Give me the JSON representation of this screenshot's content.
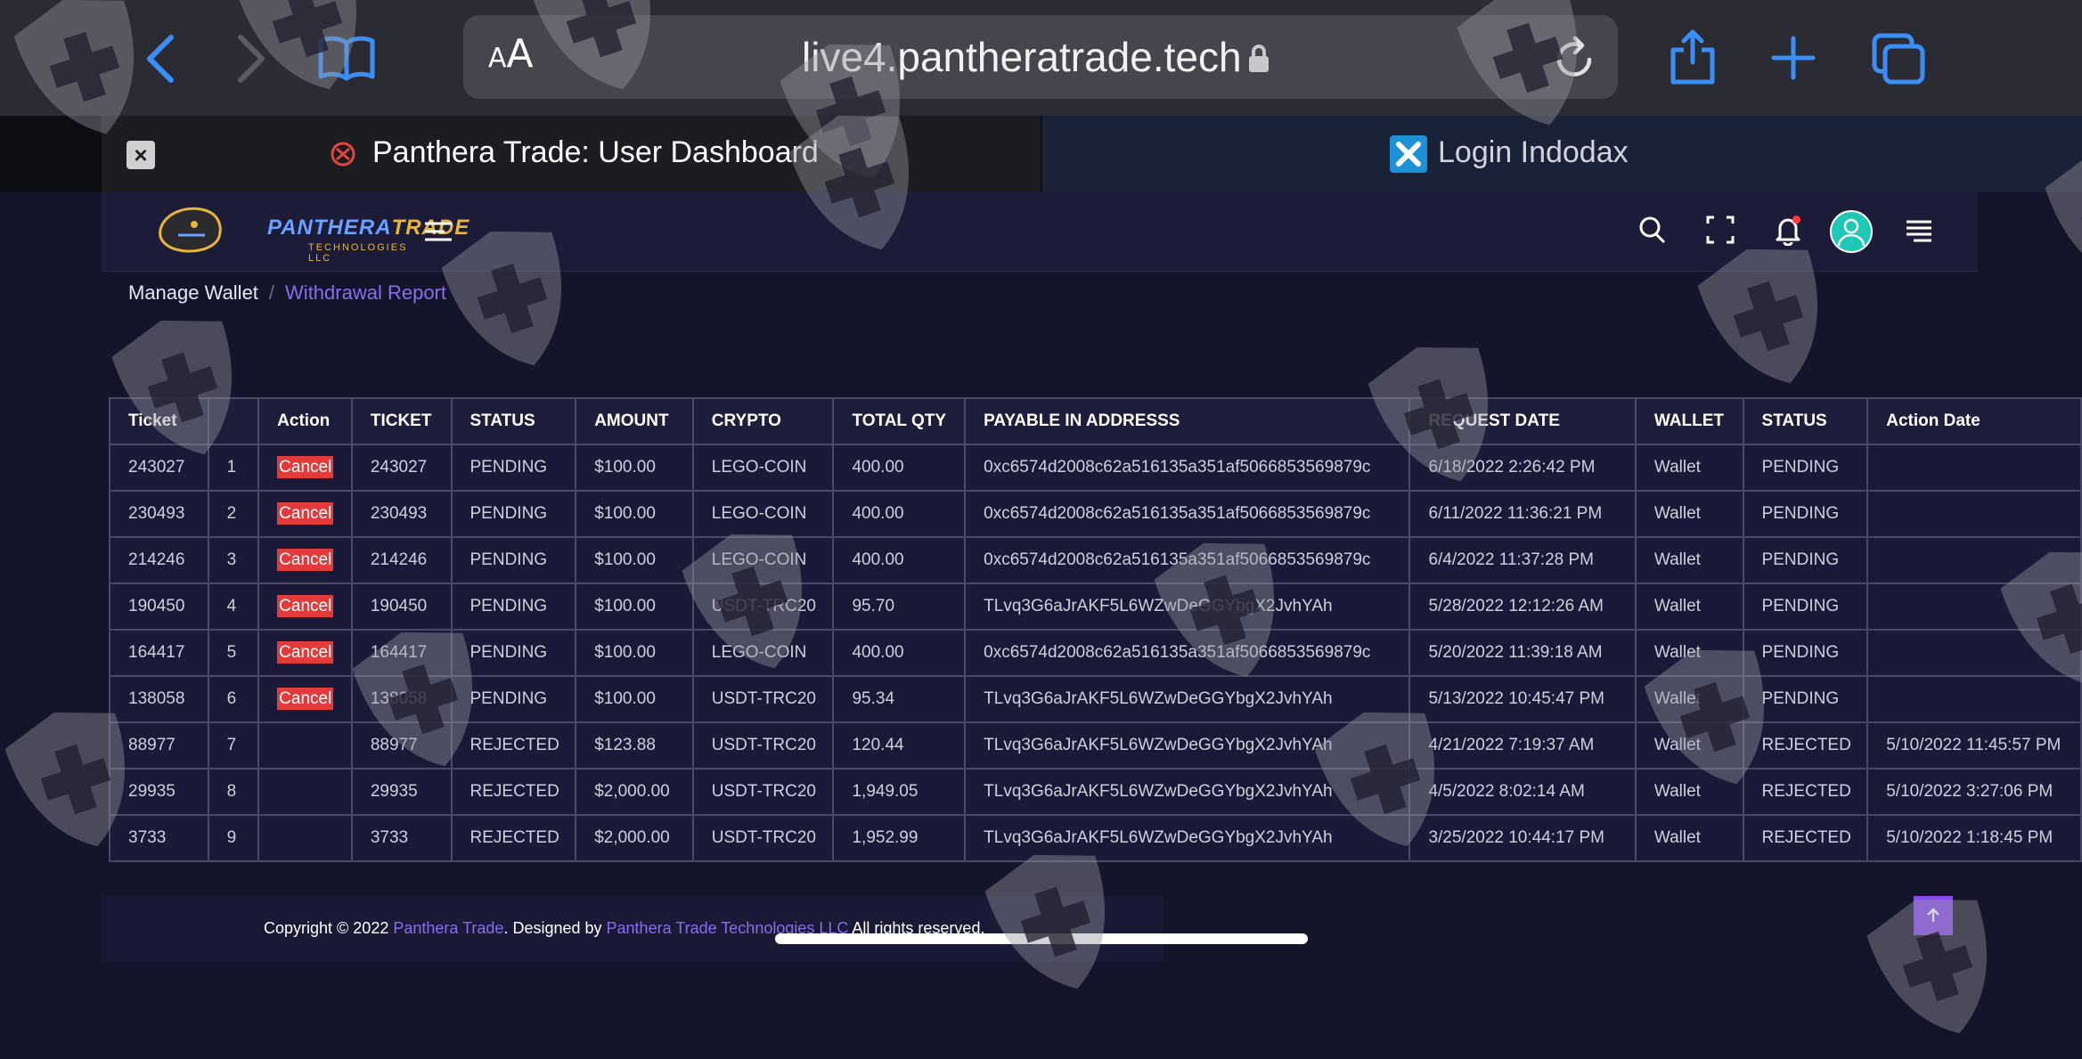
{
  "browser": {
    "text_size_label": "AA",
    "url": "live4.pantheratrade.tech",
    "tabs": [
      {
        "title": "Panthera Trade: User Dashboard"
      },
      {
        "title": "Login Indodax"
      }
    ]
  },
  "app": {
    "logo_text_a": "PANTHERA",
    "logo_text_b": "TRADE",
    "logo_subtitle": "TECHNOLOGIES LLC"
  },
  "breadcrumb": {
    "parent": "Manage Wallet",
    "separator": "/",
    "current": "Withdrawal Report"
  },
  "table": {
    "headers": [
      "Ticket",
      "",
      "Action",
      "TICKET",
      "STATUS",
      "AMOUNT",
      "CRYPTO",
      "TOTAL QTY",
      "PAYABLE IN ADDRESSS",
      "REQUEST DATE",
      "WALLET",
      "STATUS",
      "Action Date"
    ],
    "rows": [
      {
        "ticket": "243027",
        "n": "1",
        "action": "Cancel",
        "ticket2": "243027",
        "status": "PENDING",
        "amount": "$100.00",
        "crypto": "LEGO-COIN",
        "qty": "400.00",
        "address": "0xc6574d2008c62a516135a351af5066853569879c",
        "request_date": "6/18/2022 2:26:42 PM",
        "wallet": "Wallet",
        "status2": "PENDING",
        "action_date": ""
      },
      {
        "ticket": "230493",
        "n": "2",
        "action": "Cancel",
        "ticket2": "230493",
        "status": "PENDING",
        "amount": "$100.00",
        "crypto": "LEGO-COIN",
        "qty": "400.00",
        "address": "0xc6574d2008c62a516135a351af5066853569879c",
        "request_date": "6/11/2022 11:36:21 PM",
        "wallet": "Wallet",
        "status2": "PENDING",
        "action_date": ""
      },
      {
        "ticket": "214246",
        "n": "3",
        "action": "Cancel",
        "ticket2": "214246",
        "status": "PENDING",
        "amount": "$100.00",
        "crypto": "LEGO-COIN",
        "qty": "400.00",
        "address": "0xc6574d2008c62a516135a351af5066853569879c",
        "request_date": "6/4/2022 11:37:28 PM",
        "wallet": "Wallet",
        "status2": "PENDING",
        "action_date": ""
      },
      {
        "ticket": "190450",
        "n": "4",
        "action": "Cancel",
        "ticket2": "190450",
        "status": "PENDING",
        "amount": "$100.00",
        "crypto": "USDT-TRC20",
        "qty": "95.70",
        "address": "TLvq3G6aJrAKF5L6WZwDeGGYbgX2JvhYAh",
        "request_date": "5/28/2022 12:12:26 AM",
        "wallet": "Wallet",
        "status2": "PENDING",
        "action_date": ""
      },
      {
        "ticket": "164417",
        "n": "5",
        "action": "Cancel",
        "ticket2": "164417",
        "status": "PENDING",
        "amount": "$100.00",
        "crypto": "LEGO-COIN",
        "qty": "400.00",
        "address": "0xc6574d2008c62a516135a351af5066853569879c",
        "request_date": "5/20/2022 11:39:18 AM",
        "wallet": "Wallet",
        "status2": "PENDING",
        "action_date": ""
      },
      {
        "ticket": "138058",
        "n": "6",
        "action": "Cancel",
        "ticket2": "138058",
        "status": "PENDING",
        "amount": "$100.00",
        "crypto": "USDT-TRC20",
        "qty": "95.34",
        "address": "TLvq3G6aJrAKF5L6WZwDeGGYbgX2JvhYAh",
        "request_date": "5/13/2022 10:45:47 PM",
        "wallet": "Wallet",
        "status2": "PENDING",
        "action_date": ""
      },
      {
        "ticket": "88977",
        "n": "7",
        "action": "",
        "ticket2": "88977",
        "status": "REJECTED",
        "amount": "$123.88",
        "crypto": "USDT-TRC20",
        "qty": "120.44",
        "address": "TLvq3G6aJrAKF5L6WZwDeGGYbgX2JvhYAh",
        "request_date": "4/21/2022 7:19:37 AM",
        "wallet": "Wallet",
        "status2": "REJECTED",
        "action_date": "5/10/2022 11:45:57 PM"
      },
      {
        "ticket": "29935",
        "n": "8",
        "action": "",
        "ticket2": "29935",
        "status": "REJECTED",
        "amount": "$2,000.00",
        "crypto": "USDT-TRC20",
        "qty": "1,949.05",
        "address": "TLvq3G6aJrAKF5L6WZwDeGGYbgX2JvhYAh",
        "request_date": "4/5/2022 8:02:14 AM",
        "wallet": "Wallet",
        "status2": "REJECTED",
        "action_date": "5/10/2022 3:27:06 PM"
      },
      {
        "ticket": "3733",
        "n": "9",
        "action": "",
        "ticket2": "3733",
        "status": "REJECTED",
        "amount": "$2,000.00",
        "crypto": "USDT-TRC20",
        "qty": "1,952.99",
        "address": "TLvq3G6aJrAKF5L6WZwDeGGYbgX2JvhYAh",
        "request_date": "3/25/2022 10:44:17 PM",
        "wallet": "Wallet",
        "status2": "REJECTED",
        "action_date": "5/10/2022 1:18:45 PM"
      }
    ]
  },
  "footer": {
    "prefix": "Copyright © 2022 ",
    "brand": "Panthera Trade",
    "middle": ". Designed by ",
    "designer": "Panthera Trade Technologies LLC",
    "suffix": " All rights reserved."
  },
  "icons": {
    "back": "chevron-left-icon",
    "forward": "chevron-right-icon",
    "bookmarks": "book-icon",
    "lock": "lock-icon",
    "reload": "reload-icon",
    "share": "share-icon",
    "new_tab": "plus-icon",
    "tabs": "tabs-icon",
    "menu": "hamburger-icon",
    "search": "search-icon",
    "fullscreen": "fullscreen-icon",
    "notifications": "bell-icon",
    "profile": "avatar-icon",
    "settings": "list-icon",
    "scroll_top": "arrow-up-icon",
    "watermark": "shield-cross-icon"
  },
  "colors": {
    "accent": "#8b6cf0",
    "cancel_button": "#e23b3b",
    "safari_blue": "#3a8ef6",
    "page_bg": "#14142a",
    "scroll_top_button": "#8a4bf2"
  }
}
